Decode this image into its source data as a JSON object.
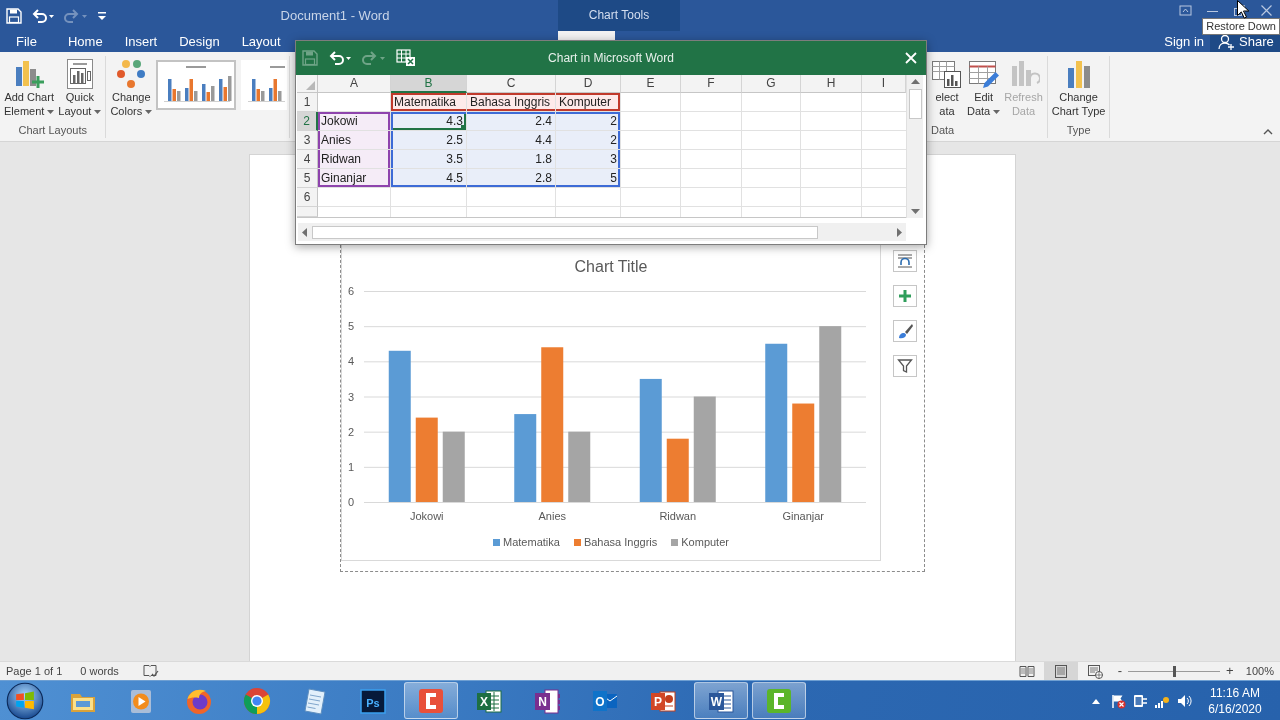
{
  "title_bar": {
    "quick_access": [
      {
        "kind": "save",
        "disabled": false
      },
      {
        "kind": "undo",
        "disabled": false
      },
      {
        "kind": "redo",
        "disabled": true
      },
      {
        "kind": "customize",
        "disabled": false
      }
    ],
    "title": "Document1 - Word",
    "context_header": "Chart Tools",
    "tooltip": "Restore Down"
  },
  "tabs": [
    {
      "label": "File",
      "selected": false
    },
    {
      "label": "Home",
      "selected": false
    },
    {
      "label": "Insert",
      "selected": false
    },
    {
      "label": "Design",
      "selected": false
    },
    {
      "label": "Layout",
      "selected": false
    },
    {
      "selected": true
    }
  ],
  "account": {
    "sign_in": "Sign in",
    "share": "Share"
  },
  "ribbon": {
    "left_groups": [
      {
        "label": "Chart Layouts",
        "buttons": [
          {
            "kind": "add_chart_element",
            "lines": [
              "Add Chart",
              "Element"
            ],
            "dropdown": true,
            "disabled": false
          },
          {
            "kind": "quick_layout",
            "lines": [
              "Quick",
              "Layout"
            ],
            "dropdown": true,
            "disabled": false
          }
        ]
      },
      {
        "buttons": [
          {
            "kind": "change_colors",
            "lines": [
              "Change",
              "Colors"
            ],
            "dropdown": true,
            "disabled": false
          }
        ],
        "styles": [
          {
            "selected": true
          },
          {
            "selected": false
          }
        ]
      }
    ],
    "right_groups": [
      {
        "label": "Data",
        "buttons": [
          {
            "kind": "select_data",
            "lines": [
              "elect",
              "ata"
            ],
            "dropdown": false,
            "disabled": false
          },
          {
            "kind": "edit_data",
            "lines": [
              "Edit",
              "Data"
            ],
            "dropdown": true,
            "disabled": false
          },
          {
            "kind": "refresh_data",
            "lines": [
              "Refresh",
              "Data"
            ],
            "dropdown": false,
            "disabled": true
          }
        ]
      },
      {
        "label": "Type",
        "buttons": [
          {
            "kind": "change_chart_type",
            "lines": [
              "Change",
              "Chart Type"
            ],
            "dropdown": false,
            "disabled": false
          }
        ]
      }
    ]
  },
  "sheet": {
    "title": "Chart in Microsoft Word",
    "toolbar": [
      {
        "kind": "save",
        "disabled": true
      },
      {
        "kind": "undo",
        "disabled": false
      },
      {
        "kind": "redo",
        "disabled": true
      },
      {
        "kind": "edit_in_excel",
        "disabled": false
      }
    ],
    "columns": [
      {
        "label": "A",
        "selected": false
      },
      {
        "label": "B",
        "selected": true
      },
      {
        "label": "C",
        "selected": false
      },
      {
        "label": "D",
        "selected": false
      },
      {
        "label": "E",
        "selected": false
      },
      {
        "label": "F",
        "selected": false
      },
      {
        "label": "G",
        "selected": false
      },
      {
        "label": "H",
        "selected": false
      },
      {
        "label": "I",
        "selected": false
      }
    ],
    "rows": [
      {
        "number": "1",
        "kind": "series_names",
        "selected": false,
        "cells": [
          {
            "text": "Matematika",
            "selected": false
          },
          {
            "text": "Bahasa Inggris",
            "selected": false
          },
          {
            "text": "Komputer",
            "selected": false
          }
        ]
      },
      {
        "number": "2",
        "kind": "data",
        "selected": true,
        "label": {
          "text": "Jokowi",
          "selected": false
        },
        "cells": [
          {
            "text": "4.3",
            "selected": true
          },
          {
            "text": "2.4",
            "selected": false
          },
          {
            "text": "2",
            "selected": false
          }
        ]
      },
      {
        "number": "3",
        "kind": "data",
        "selected": false,
        "label": {
          "text": "Anies",
          "selected": false
        },
        "cells": [
          {
            "text": "2.5",
            "selected": false
          },
          {
            "text": "4.4",
            "selected": false
          },
          {
            "text": "2",
            "selected": false
          }
        ]
      },
      {
        "number": "4",
        "kind": "data",
        "selected": false,
        "label": {
          "text": "Ridwan",
          "selected": false
        },
        "cells": [
          {
            "text": "3.5",
            "selected": false
          },
          {
            "text": "1.8",
            "selected": false
          },
          {
            "text": "3",
            "selected": false
          }
        ]
      },
      {
        "number": "5",
        "kind": "data",
        "selected": false,
        "label": {
          "text": "Ginanjar",
          "selected": false
        },
        "cells": [
          {
            "text": "4.5",
            "selected": false
          },
          {
            "text": "2.8",
            "selected": false
          },
          {
            "text": "5",
            "selected": false
          }
        ]
      },
      {
        "number": "6",
        "kind": "empty",
        "selected": false
      }
    ]
  },
  "document": {
    "chart": {
      "chart_data": {
        "type": "bar",
        "orientation": "vertical",
        "title": "Chart Title",
        "categories": [
          "Jokowi",
          "Anies",
          "Ridwan",
          "Ginanjar"
        ],
        "series": [
          {
            "name": "Matematika",
            "color": "#5b9bd5",
            "values": [
              4.3,
              2.5,
              3.5,
              4.5
            ]
          },
          {
            "name": "Bahasa Inggris",
            "color": "#ed7d31",
            "values": [
              2.4,
              4.4,
              1.8,
              2.8
            ]
          },
          {
            "name": "Komputer",
            "color": "#a5a5a5",
            "values": [
              2,
              2,
              3,
              5
            ]
          }
        ],
        "ylim": [
          0,
          6
        ],
        "yticks": [
          0,
          1,
          2,
          3,
          4,
          5,
          6
        ],
        "grid": true,
        "legend": true
      },
      "side_buttons": [
        {
          "kind": "layout_options"
        },
        {
          "kind": "chart_elements"
        },
        {
          "kind": "chart_styles"
        },
        {
          "kind": "chart_filters"
        }
      ]
    }
  },
  "status_bar": {
    "page": "Page 1 of 1",
    "words": "0 words",
    "views": [
      {
        "kind": "read_mode",
        "selected": false
      },
      {
        "kind": "print_layout",
        "selected": true
      },
      {
        "kind": "web_layout",
        "selected": false
      }
    ],
    "zoom_out": "-",
    "zoom": {
      "level": 0.5
    },
    "zoom_in": "+",
    "zoom_label": "100%"
  },
  "taskbar": {
    "apps": [
      {
        "kind": "folder",
        "selected": false
      },
      {
        "kind": "player",
        "selected": false
      },
      {
        "kind": "fox_browser",
        "selected": false
      },
      {
        "kind": "wheel_browser",
        "selected": false
      },
      {
        "kind": "notepad",
        "selected": false
      },
      {
        "kind": "ps_tile",
        "glyph": "Ps",
        "selected": false
      },
      {
        "kind": "red_bracket",
        "selected": true
      },
      {
        "kind": "x_tile",
        "glyph": "X",
        "selected": false
      },
      {
        "kind": "n_tile",
        "glyph": "N",
        "selected": false
      },
      {
        "kind": "o_tile",
        "glyph": "O",
        "selected": false
      },
      {
        "kind": "p_tile",
        "glyph": "P",
        "selected": false
      },
      {
        "kind": "w_tile",
        "glyph": "W",
        "selected": true
      },
      {
        "kind": "green_bracket",
        "selected": true
      }
    ],
    "tray": [
      {
        "kind": "show_hidden"
      },
      {
        "kind": "action_center"
      },
      {
        "kind": "power"
      },
      {
        "kind": "network"
      },
      {
        "kind": "volume"
      }
    ],
    "time": "11:16 AM",
    "date": "6/16/2020"
  }
}
